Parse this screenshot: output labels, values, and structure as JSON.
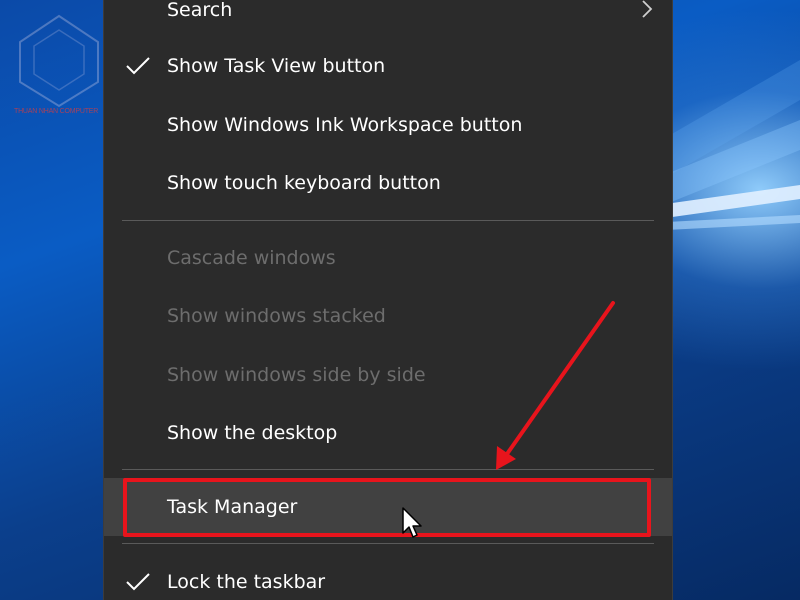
{
  "watermark": {
    "text": "THUAN NHAN COMPUTER"
  },
  "context_menu": {
    "items": [
      {
        "label": "Search",
        "checked": false,
        "disabled": false,
        "submenu": true
      },
      {
        "label": "Show Task View button",
        "checked": true,
        "disabled": false
      },
      {
        "label": "Show Windows Ink Workspace button",
        "checked": false,
        "disabled": false
      },
      {
        "label": "Show touch keyboard button",
        "checked": false,
        "disabled": false
      },
      {
        "label": "Cascade windows",
        "checked": false,
        "disabled": true
      },
      {
        "label": "Show windows stacked",
        "checked": false,
        "disabled": true
      },
      {
        "label": "Show windows side by side",
        "checked": false,
        "disabled": true
      },
      {
        "label": "Show the desktop",
        "checked": false,
        "disabled": false
      },
      {
        "label": "Task Manager",
        "checked": false,
        "disabled": false,
        "highlighted": true
      },
      {
        "label": "Lock the taskbar",
        "checked": true,
        "disabled": false
      }
    ]
  },
  "colors": {
    "menu_background": "#2b2b2b",
    "menu_text": "#ffffff",
    "disabled_text": "#6d6d6d",
    "highlight_background": "#414141",
    "annotation_red": "#e8141c"
  },
  "icons": {
    "checkmark": "checkmark-icon",
    "submenu": "chevron-right-icon",
    "pointer": "mouse-pointer-icon",
    "annotation_arrow": "red-arrow-annotation"
  }
}
